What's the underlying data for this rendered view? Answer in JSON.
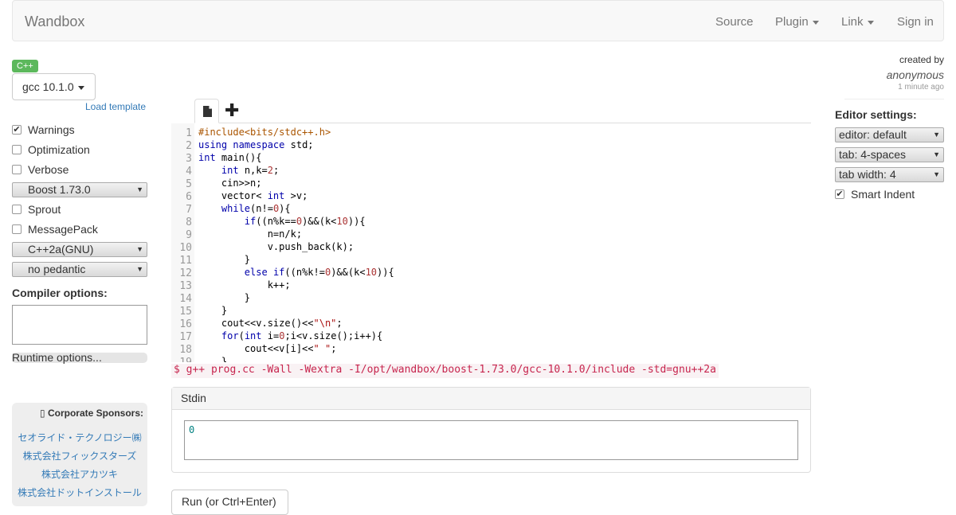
{
  "navbar": {
    "brand": "Wandbox",
    "items": [
      {
        "label": "Source",
        "dropdown": false
      },
      {
        "label": "Plugin",
        "dropdown": true
      },
      {
        "label": "Link",
        "dropdown": true
      },
      {
        "label": "Sign in",
        "dropdown": false
      }
    ]
  },
  "sidebar": {
    "language_badge": "C++",
    "compiler": "gcc 10.1.0",
    "load_template": "Load template",
    "options": {
      "warnings": {
        "label": "Warnings",
        "checked": true
      },
      "optimization": {
        "label": "Optimization",
        "checked": false
      },
      "verbose": {
        "label": "Verbose",
        "checked": false
      },
      "boost": "Boost 1.73.0",
      "sprout": {
        "label": "Sprout",
        "checked": false
      },
      "messagepack": {
        "label": "MessagePack",
        "checked": false
      },
      "std": "C++2a(GNU)",
      "pedantic": "no pedantic"
    },
    "compiler_options_title": "Compiler options:",
    "runtime_options": "Runtime options...",
    "sponsors": {
      "title": "Corporate Sponsors:",
      "icon": "building-icon",
      "items": [
        "セオライド・テクノロジー㈱",
        "株式会社フィックスターズ",
        "株式会社アカツキ",
        "株式会社ドットインストール"
      ]
    }
  },
  "editor": {
    "line_numbers": [
      "1",
      "2",
      "3",
      "4",
      "5",
      "6",
      "7",
      "8",
      "9",
      "10",
      "11",
      "12",
      "13",
      "14",
      "15",
      "16",
      "17",
      "18",
      "19"
    ],
    "code_lines": [
      "#include<bits/stdc++.h>",
      "using namespace std;",
      "int main(){",
      "    int n,k=2;",
      "    cin>>n;",
      "    vector< int >v;",
      "    while(n!=0){",
      "        if((n%k==0)&&(k<10)){",
      "            n=n/k;",
      "            v.push_back(k);",
      "        }",
      "        else if((n%k!=0)&&(k<10)){",
      "            k++;",
      "        }",
      "    }",
      "    cout<<v.size()<<\"\\n\";",
      "    for(int i=0;i<v.size();i++){",
      "        cout<<v[i]<<\" \";",
      "    }"
    ]
  },
  "command_line": "$ g++ prog.cc -Wall -Wextra -I/opt/wandbox/boost-1.73.0/gcc-10.1.0/include -std=gnu++2a",
  "stdin": {
    "title": "Stdin",
    "value": "0"
  },
  "run_button": "Run (or Ctrl+Enter)",
  "author": {
    "created_by": "created by",
    "name": "anonymous",
    "time": "1 minute ago"
  },
  "editor_settings": {
    "title": "Editor settings:",
    "editor": "editor: default",
    "tab": "tab: 4-spaces",
    "tab_width": "tab width: 4",
    "smart_indent": {
      "label": "Smart Indent",
      "checked": true
    }
  },
  "colors": {
    "accent": "#337ab7",
    "badge": "#5cb85c",
    "command": "#c7254e"
  }
}
